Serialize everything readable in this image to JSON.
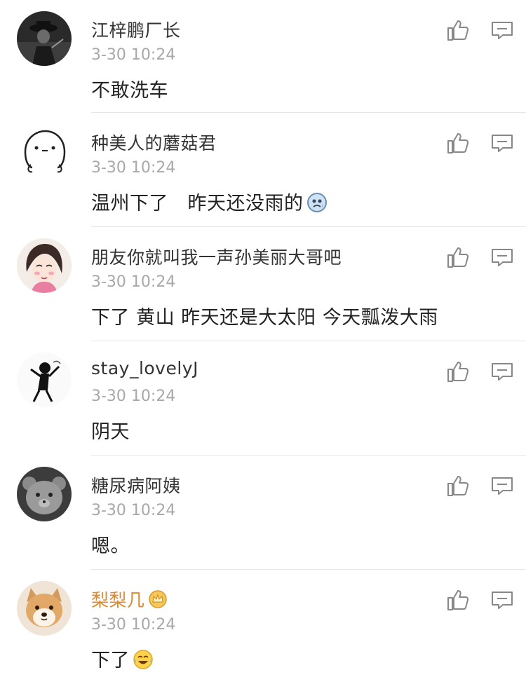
{
  "comments": [
    {
      "user": "江梓鹏厂长",
      "time": "3-30 10:24",
      "text": "不敢洗车",
      "avatar": "man-with-hat-avatar"
    },
    {
      "user": "种美人的蘑菇君",
      "time": "3-30 10:24",
      "text": "温州下了　昨天还没雨的",
      "avatar": "doodle-face-avatar",
      "emoji": "sad-cloud-emoji"
    },
    {
      "user": "朋友你就叫我一声孙美丽大哥吧",
      "time": "3-30 10:24",
      "text": "下了 黄山 昨天还是大太阳 今天瓢泼大雨",
      "avatar": "cartoon-girl-avatar"
    },
    {
      "user": "stay_lovelyJ",
      "time": "3-30 10:24",
      "text": "阴天",
      "avatar": "sketch-figure-avatar"
    },
    {
      "user": "糖尿病阿姨",
      "time": "3-30 10:24",
      "text": "嗯。",
      "avatar": "gray-bear-avatar"
    },
    {
      "user": "梨梨几",
      "time": "3-30 10:24",
      "text": "下了",
      "avatar": "shiba-dog-avatar",
      "emoji": "laugh-cry-emoji",
      "badge": "crown-badge-icon",
      "vip_color": "#e08a2c"
    }
  ],
  "colors": {
    "name": "#333333",
    "time": "#a8a8a8",
    "text": "#222222",
    "icon": "#888888",
    "divider": "#e6e6e6"
  },
  "icons": {
    "like": "thumbs-up-icon",
    "reply": "comment-bubble-icon"
  }
}
